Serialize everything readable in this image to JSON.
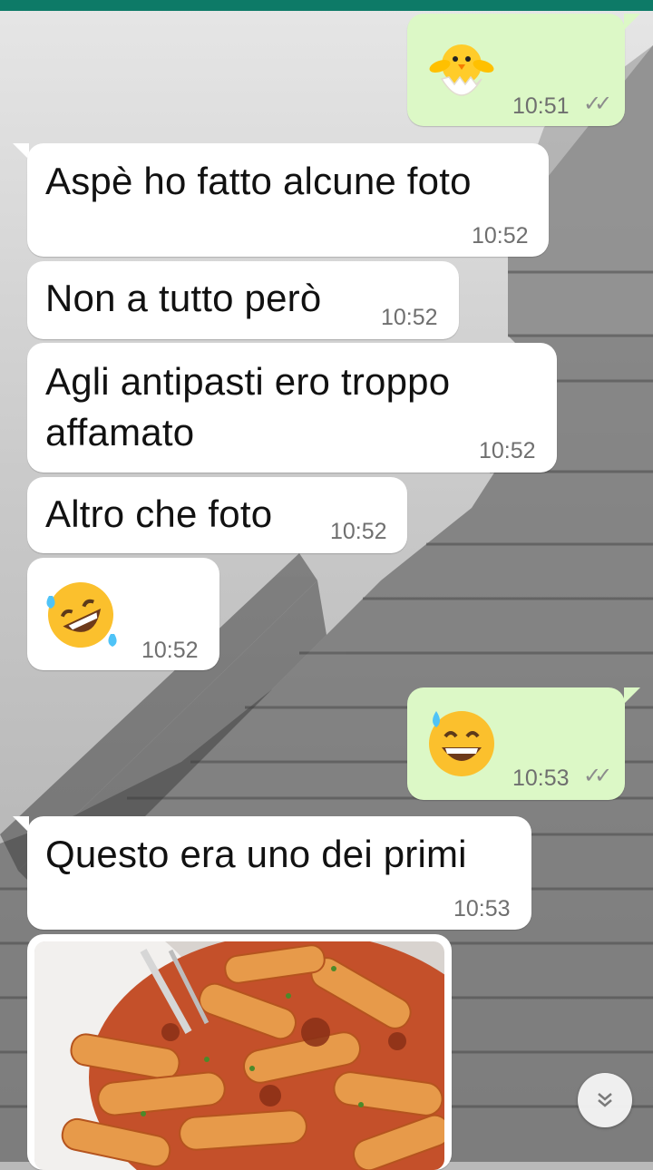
{
  "messages": [
    {
      "id": "m1",
      "direction": "outgoing",
      "emoji": "hatching-chick",
      "time": "10:51",
      "status": "read"
    },
    {
      "id": "m2",
      "direction": "incoming",
      "text": "Aspè ho fatto alcune foto",
      "time": "10:52"
    },
    {
      "id": "m3",
      "direction": "incoming",
      "text": "Non a tutto però",
      "time": "10:52"
    },
    {
      "id": "m4",
      "direction": "incoming",
      "text_lines": [
        "Agli antipasti ero troppo",
        "affamato"
      ],
      "time": "10:52"
    },
    {
      "id": "m5",
      "direction": "incoming",
      "text": "Altro che foto",
      "time": "10:52"
    },
    {
      "id": "m6",
      "direction": "incoming",
      "emoji": "rolling-on-floor-laughing",
      "time": "10:52"
    },
    {
      "id": "m7",
      "direction": "outgoing",
      "emoji": "grinning-face-with-sweat",
      "time": "10:53",
      "status": "read"
    },
    {
      "id": "m8",
      "direction": "incoming",
      "text": "Questo era uno dei primi",
      "time": "10:53"
    },
    {
      "id": "m9",
      "direction": "incoming",
      "type": "image",
      "image": "pasta-with-tomato-sauce"
    }
  ],
  "scroll_button_icon": "double-chevron-down-icon",
  "colors": {
    "accent": "#0d7a67",
    "incoming_bubble": "#ffffff",
    "outgoing_bubble": "#dcf8c6",
    "read_ticks": "#8c8c8c"
  }
}
